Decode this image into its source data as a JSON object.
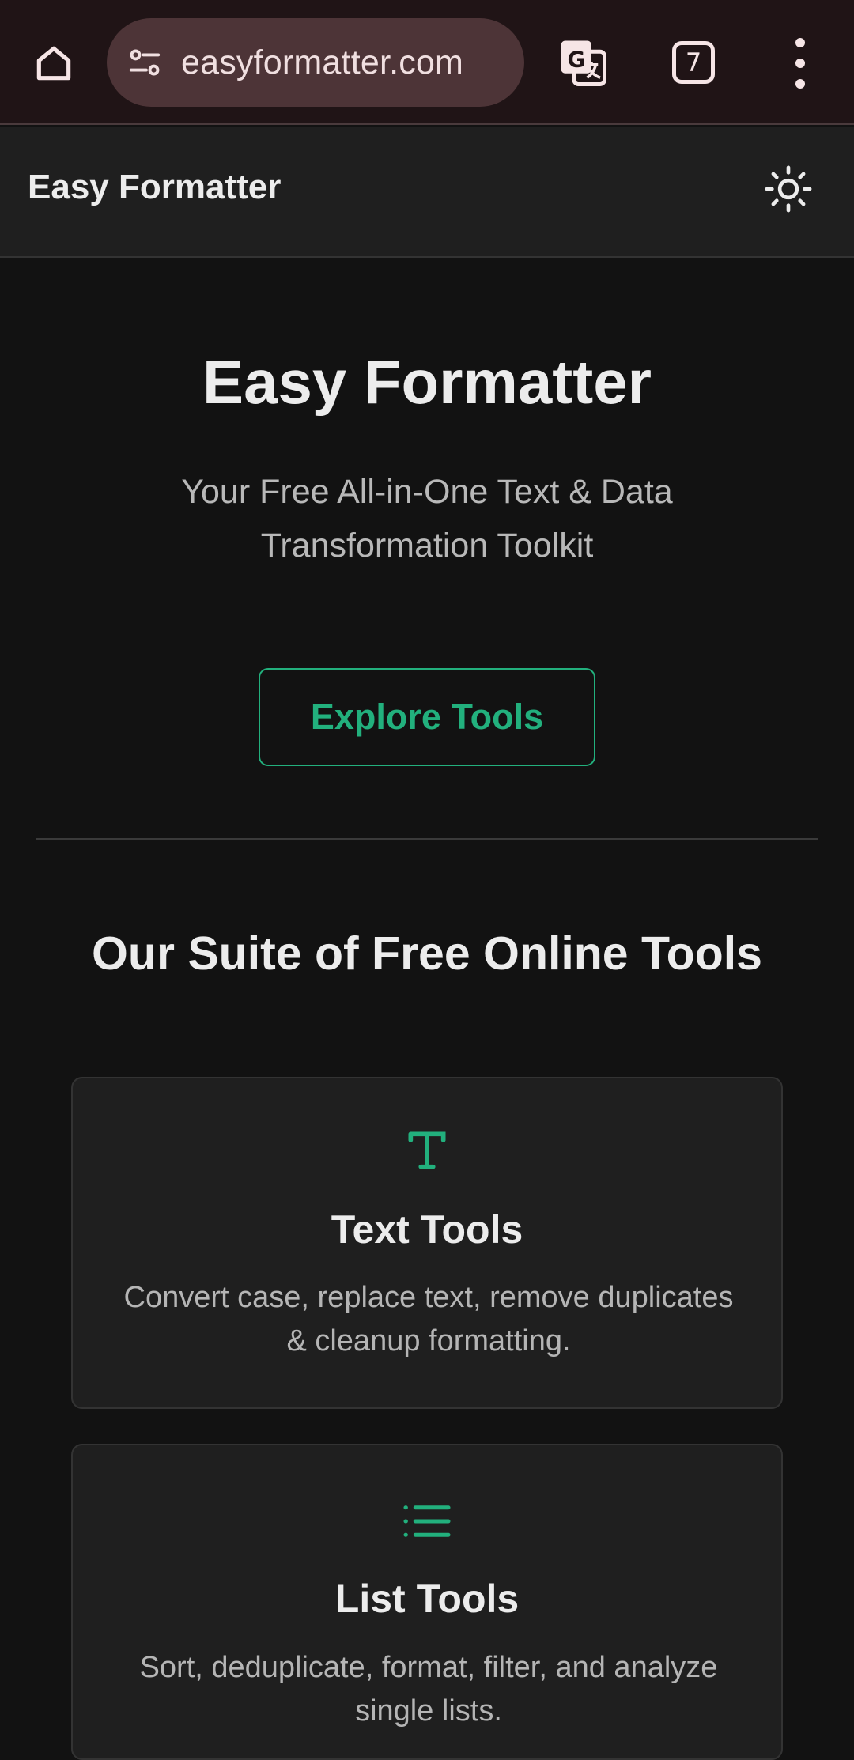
{
  "browser": {
    "url": "easyformatter.com",
    "tab_count": "7",
    "icons": {
      "home": "home-icon",
      "site_info": "tune-icon",
      "translate": "translate-icon",
      "menu": "more-vert-icon"
    }
  },
  "header": {
    "brand": "Easy Formatter",
    "theme_icon": "sun-icon"
  },
  "hero": {
    "title": "Easy Formatter",
    "subtitle": "Your Free All-in-One Text & Data Transformation Toolkit",
    "cta_label": "Explore Tools"
  },
  "tools_section": {
    "title": "Our Suite of Free Online Tools",
    "cards": [
      {
        "icon": "text-t-icon",
        "title": "Text Tools",
        "description": "Convert case, replace text, remove duplicates & cleanup formatting."
      },
      {
        "icon": "list-icon",
        "title": "List Tools",
        "description": "Sort, deduplicate, format, filter, and analyze single lists."
      }
    ]
  },
  "colors": {
    "accent": "#22b07d",
    "background": "#121212",
    "surface": "#1f1f1f",
    "browser_bar": "#201416",
    "url_pill": "#4d3437"
  }
}
